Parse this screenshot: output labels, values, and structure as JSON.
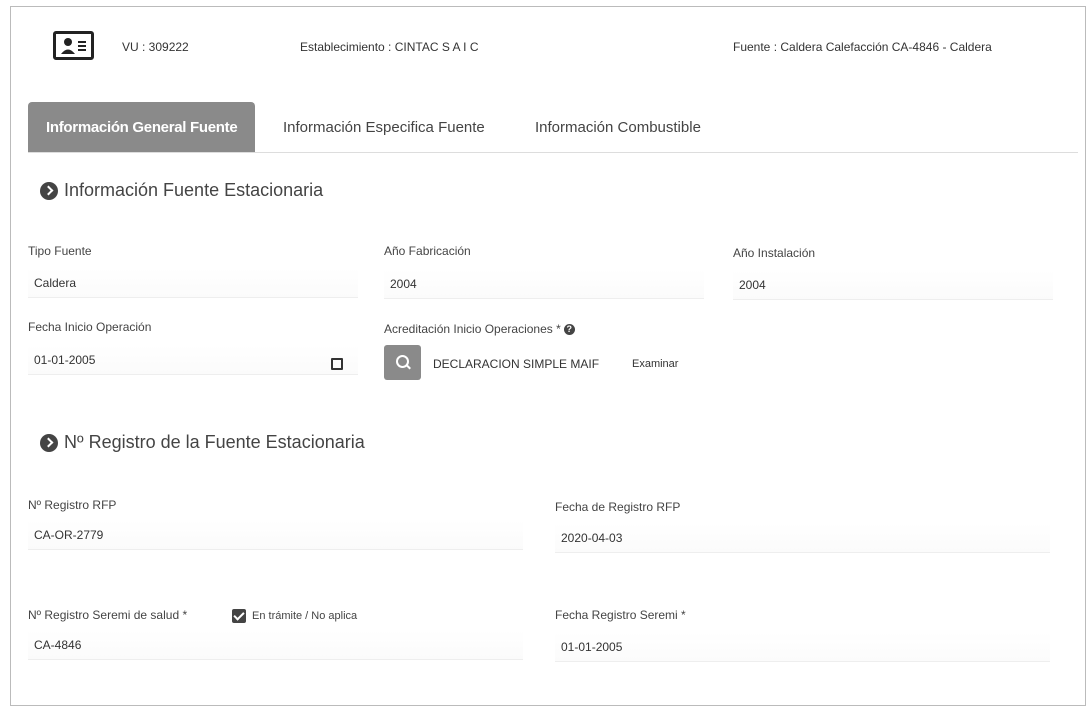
{
  "header": {
    "vu": "VU : 309222",
    "establecimiento": "Establecimiento : CINTAC S A I C",
    "fuente": "Fuente : Caldera Calefacción CA-4846 - Caldera",
    "icon": "id-card-icon"
  },
  "tabs": [
    {
      "label": "Información General Fuente",
      "active": true
    },
    {
      "label": "Información Especifica Fuente",
      "active": false
    },
    {
      "label": "Información Combustible",
      "active": false
    }
  ],
  "section1": {
    "title": "Información Fuente Estacionaria",
    "tipo_fuente": {
      "label": "Tipo Fuente",
      "value": "Caldera"
    },
    "anio_fabricacion": {
      "label": "Año Fabricación",
      "value": "2004"
    },
    "anio_instalacion": {
      "label": "Año Instalación",
      "value": "2004"
    },
    "fecha_inicio": {
      "label": "Fecha Inicio Operación",
      "value": "01-01-2005"
    },
    "acreditacion": {
      "label": "Acreditación Inicio Operaciones *",
      "file": "DECLARACION SIMPLE MAIF",
      "browse": "Examinar"
    }
  },
  "section2": {
    "title": "Nº Registro de la Fuente Estacionaria",
    "registro_rfp": {
      "label": "Nº Registro RFP",
      "value": "CA-OR-2779"
    },
    "fecha_rfp": {
      "label": "Fecha de Registro RFP",
      "value": "2020-04-03"
    },
    "registro_seremi": {
      "label": "Nº Registro Seremi de salud *",
      "checkbox_label": "En trámite / No aplica",
      "value": "CA-4846"
    },
    "fecha_seremi": {
      "label": "Fecha Registro Seremi *",
      "value": "01-01-2005"
    }
  },
  "colors": {
    "accent": "#8a8a8a",
    "text": "#333333"
  }
}
